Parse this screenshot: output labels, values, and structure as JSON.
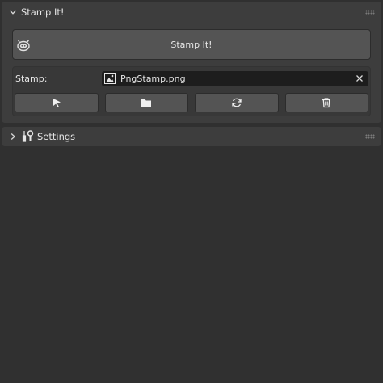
{
  "stamp_panel": {
    "title": "Stamp It!",
    "stamp_button_label": "Stamp It!",
    "stamp_label": "Stamp:",
    "stamp_file": "PngStamp.png",
    "tools": [
      {
        "name": "select-icon"
      },
      {
        "name": "folder-icon"
      },
      {
        "name": "refresh-icon"
      },
      {
        "name": "trash-icon"
      }
    ]
  },
  "settings_panel": {
    "title": "Settings"
  },
  "colors": {
    "background": "#303030",
    "panel": "#3d3d3d",
    "button": "#545454",
    "field": "#1d1d1d"
  }
}
